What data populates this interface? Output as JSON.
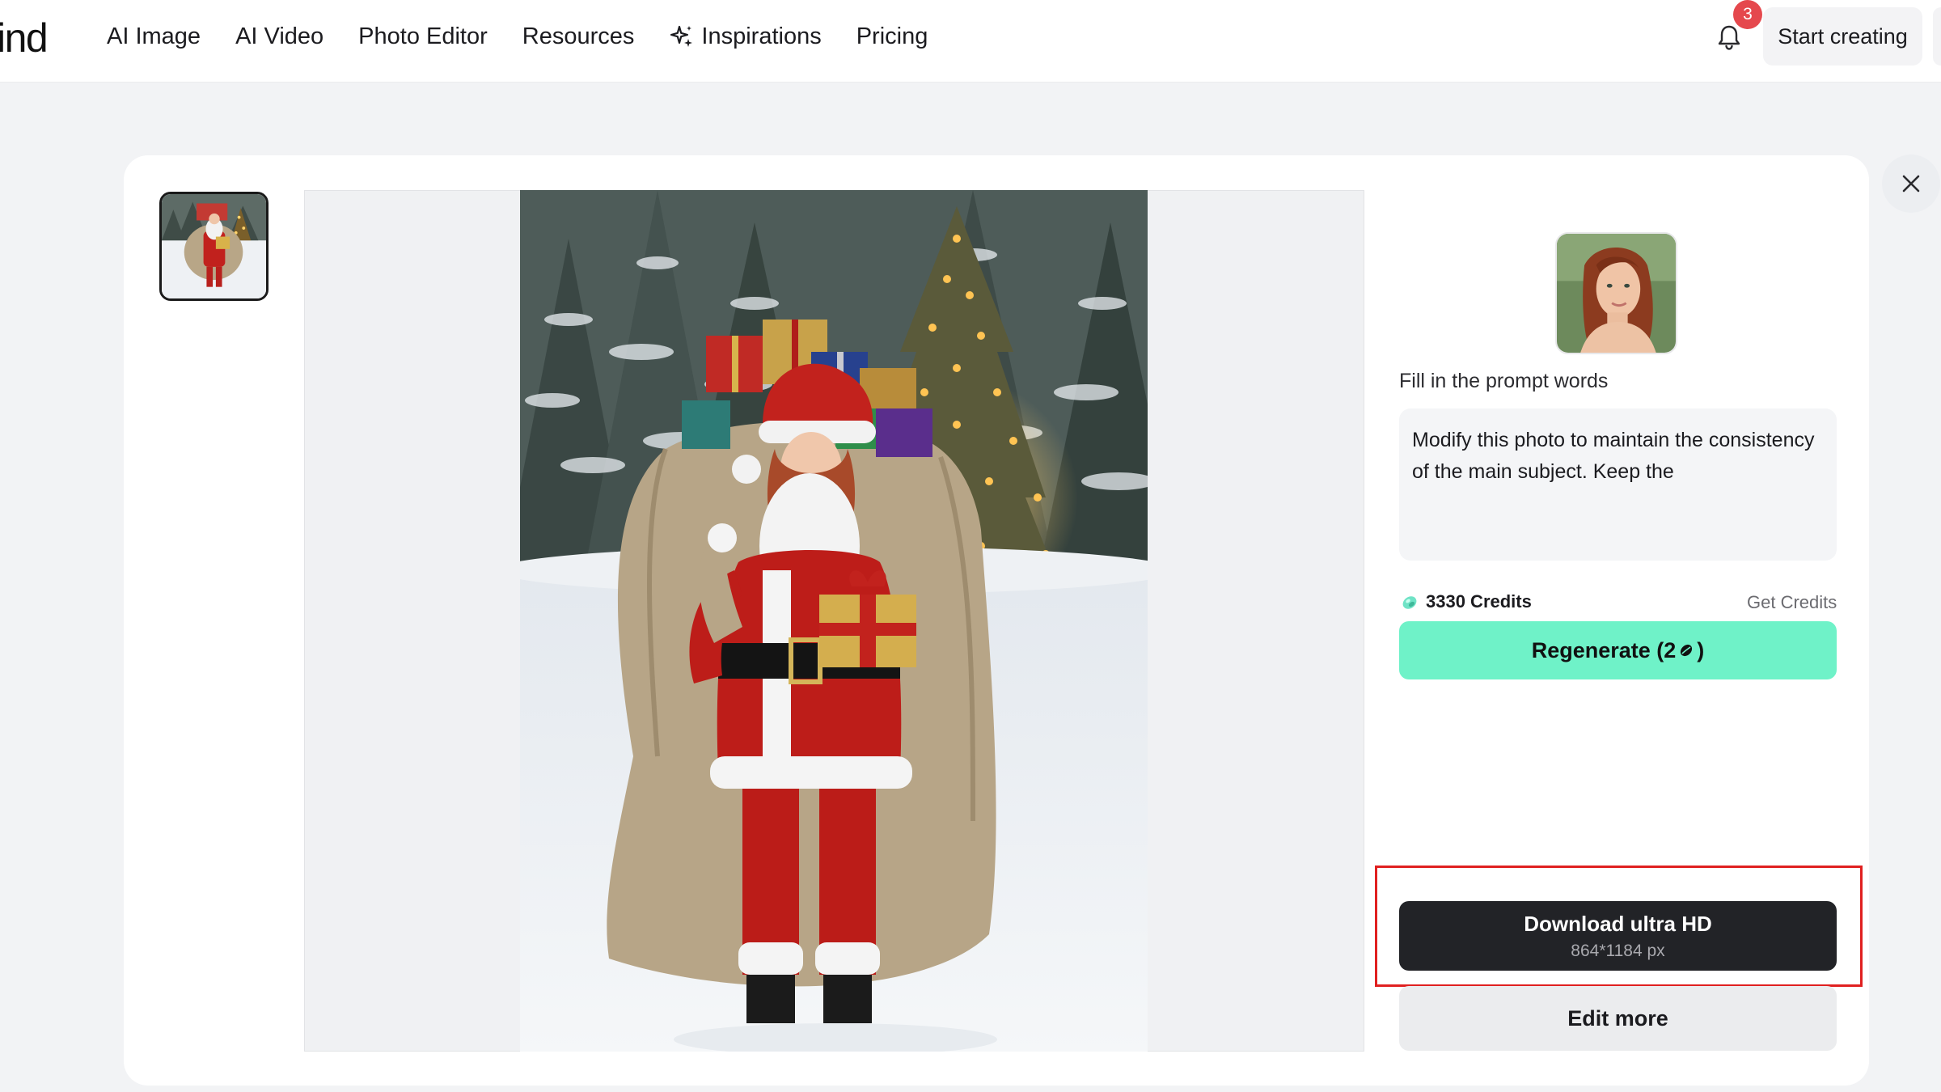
{
  "header": {
    "logo_text": "ind",
    "nav": [
      {
        "label": "AI Image",
        "icon": null
      },
      {
        "label": "AI Video",
        "icon": null
      },
      {
        "label": "Photo Editor",
        "icon": null
      },
      {
        "label": "Resources",
        "icon": null
      },
      {
        "label": "Inspirations",
        "icon": "sparkle-icon"
      },
      {
        "label": "Pricing",
        "icon": null
      }
    ],
    "notification_count": "3",
    "start_label": "Start creating"
  },
  "panel": {
    "prompt_label": "Fill in the prompt words",
    "prompt_text": "Modify this photo to maintain the consistency of the main subject. Keep the",
    "credits": "3330 Credits",
    "get_credits": "Get Credits",
    "regenerate_prefix": "Regenerate (2",
    "regenerate_suffix": ")",
    "download_label": "Download ultra HD",
    "download_resolution": "864*1184 px",
    "edit_label": "Edit more"
  },
  "colors": {
    "accent": "#6ff2c8",
    "download_bg": "#222327",
    "badge": "#e5484d",
    "highlight": "#e02020"
  },
  "icons": {
    "close": "close-icon",
    "bell": "bell-icon",
    "credits": "credit-gem-icon"
  }
}
